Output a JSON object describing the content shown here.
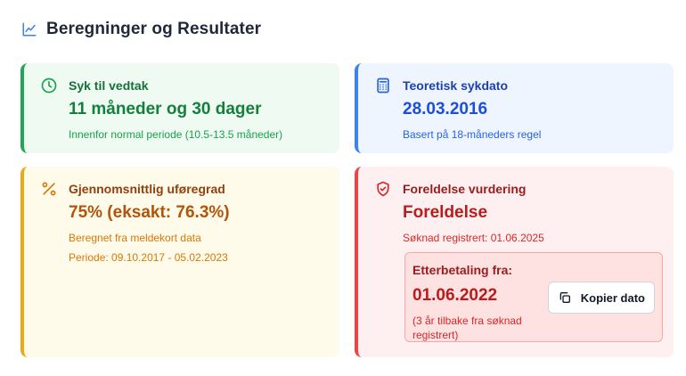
{
  "header": {
    "title": "Beregninger og Resultater",
    "icon": "line-chart-icon"
  },
  "cards": {
    "sick_until_decision": {
      "icon": "clock-icon",
      "title": "Syk til vedtak",
      "value": "11 måneder og 30 dager",
      "note": "Innenfor normal periode (10.5-13.5 måneder)",
      "accent": "#22a654"
    },
    "theoretical_sick_date": {
      "icon": "calculator-icon",
      "title": "Teoretisk sykdato",
      "value": "28.03.2016",
      "note": "Basert på 18-måneders regel",
      "accent": "#3b82f6"
    },
    "average_disability": {
      "icon": "percent-icon",
      "title": "Gjennomsnittlig uføregrad",
      "value": "75% (eksakt: 76.3%)",
      "note": "Beregnet fra meldekort data",
      "period": "Periode: 09.10.2017 - 05.02.2023",
      "accent": "#eaa916"
    },
    "limitation": {
      "icon": "shield-check-icon",
      "title": "Foreldelse vurdering",
      "value": "Foreldelse",
      "note": "Søknad registrert: 01.06.2025",
      "accent": "#ef4444",
      "backpay": {
        "label": "Etterbetaling fra:",
        "date": "01.06.2022",
        "note": "(3 år tilbake fra søknad registrert)",
        "copy_button": "Kopier dato",
        "copy_icon": "copy-icon"
      }
    }
  }
}
